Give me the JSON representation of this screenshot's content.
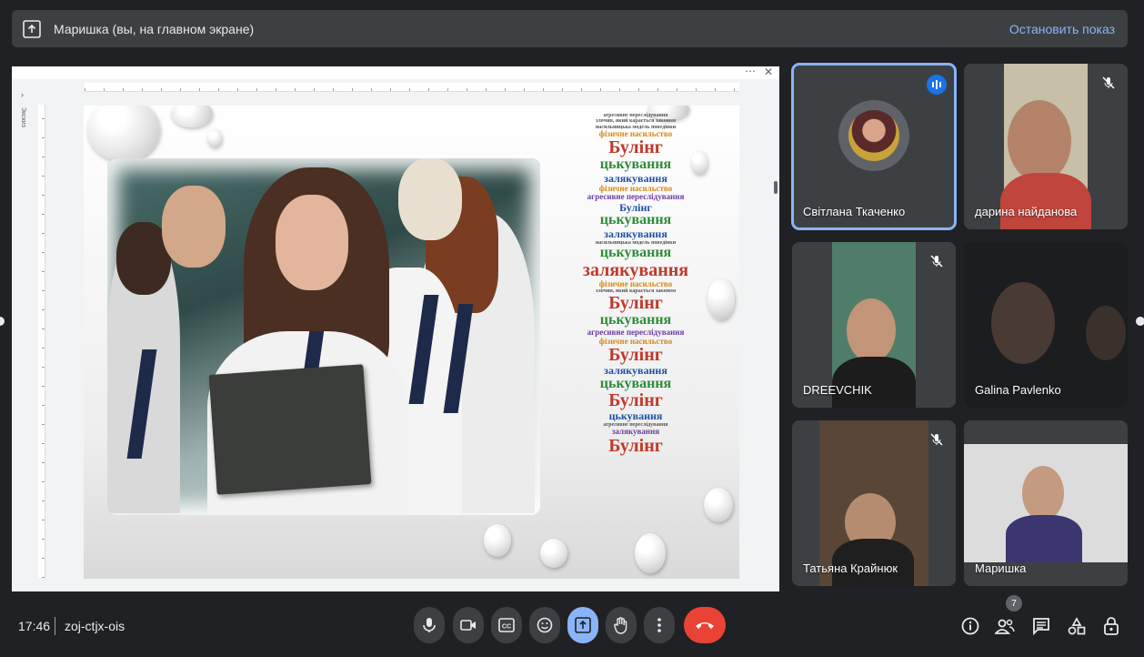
{
  "presenting_bar": {
    "text": "Маришка (вы, на главном экране)",
    "stop_label": "Остановить показ"
  },
  "slide_window": {
    "side_label": "Экскиз",
    "wordcloud": [
      {
        "t": "агресивне переслідування",
        "c": "w-sm"
      },
      {
        "t": "злочин, який карається законом",
        "c": "w-sm"
      },
      {
        "t": "насильницька модель поведінки",
        "c": "w-sm"
      },
      {
        "t": "фізичне насильство",
        "c": "w-orange"
      },
      {
        "t": "Булінг",
        "c": "w-red"
      },
      {
        "t": "цькування",
        "c": "w-green"
      },
      {
        "t": "залякування",
        "c": "w-blue"
      },
      {
        "t": "фізичне насильство",
        "c": "w-orange"
      },
      {
        "t": "агресивне переслідування",
        "c": "w-violet"
      },
      {
        "t": "Булінг",
        "c": "w-blue"
      },
      {
        "t": "цькування",
        "c": "w-green"
      },
      {
        "t": "залякування",
        "c": "w-blue"
      },
      {
        "t": "насильницька модель поведінки",
        "c": "w-sm"
      },
      {
        "t": "цькування",
        "c": "w-green"
      },
      {
        "t": "залякування",
        "c": "w-red"
      },
      {
        "t": "фізичне насильство",
        "c": "w-orange"
      },
      {
        "t": "злочин, який карається законом",
        "c": "w-sm"
      },
      {
        "t": "Булінг",
        "c": "w-red"
      },
      {
        "t": "цькування",
        "c": "w-green"
      },
      {
        "t": "агресивне переслідування",
        "c": "w-violet"
      },
      {
        "t": "фізичне насильство",
        "c": "w-orange"
      },
      {
        "t": "Булінг",
        "c": "w-red"
      },
      {
        "t": "залякування",
        "c": "w-blue"
      },
      {
        "t": "цькування",
        "c": "w-green"
      },
      {
        "t": "Булінг",
        "c": "w-red"
      },
      {
        "t": "цькування",
        "c": "w-blue"
      },
      {
        "t": "агресивне переслідування",
        "c": "w-sm"
      },
      {
        "t": "залякування",
        "c": "w-violet"
      },
      {
        "t": "Булінг",
        "c": "w-red"
      }
    ]
  },
  "participants": [
    {
      "name": "Світлана Ткаченко"
    },
    {
      "name": "дарина найданова"
    },
    {
      "name": "DREEVCHIK"
    },
    {
      "name": "Galina Pavlenko"
    },
    {
      "name": "Татьяна Крайнюк"
    },
    {
      "name": "Маришка"
    }
  ],
  "bottom_bar": {
    "time": "17:46",
    "meeting_code": "zoj-ctjx-ois",
    "participants_count": "7"
  },
  "colors": {
    "background": "#202124",
    "bar": "#3c4043",
    "accent": "#8ab4f8",
    "hangup": "#ea4335"
  }
}
